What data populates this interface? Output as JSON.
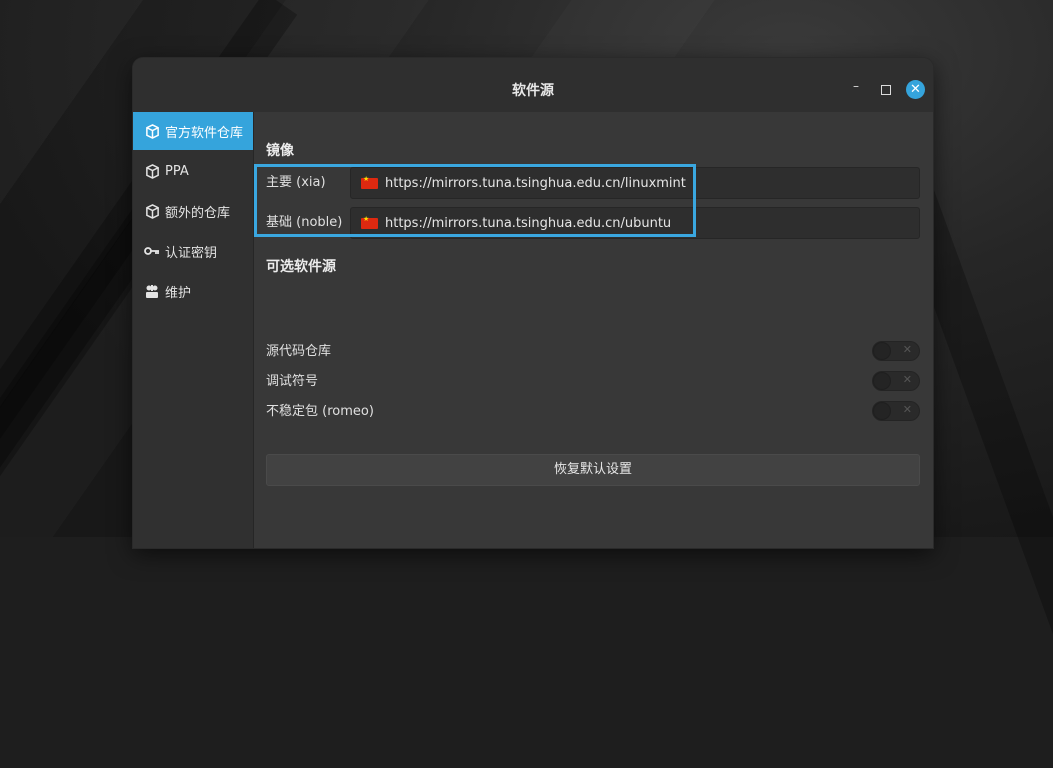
{
  "window": {
    "title": "软件源"
  },
  "sidebar": {
    "items": [
      {
        "label": "官方软件仓库",
        "icon": "package-icon",
        "active": true
      },
      {
        "label": "PPA",
        "icon": "package-icon",
        "active": false
      },
      {
        "label": "额外的仓库",
        "icon": "package-icon",
        "active": false
      },
      {
        "label": "认证密钥",
        "icon": "key-icon",
        "active": false
      },
      {
        "label": "维护",
        "icon": "maintenance-icon",
        "active": false
      }
    ]
  },
  "mirrors": {
    "title": "镜像",
    "main": {
      "label": "主要 (xia)",
      "url": "https://mirrors.tuna.tsinghua.edu.cn/linuxmint"
    },
    "base": {
      "label": "基础 (noble)",
      "url": "https://mirrors.tuna.tsinghua.edu.cn/ubuntu"
    }
  },
  "optional": {
    "title": "可选软件源",
    "items": [
      {
        "label": "源代码仓库",
        "enabled": false
      },
      {
        "label": "调试符号",
        "enabled": false
      },
      {
        "label": "不稳定包 (romeo)",
        "enabled": false
      }
    ]
  },
  "reset_label": "恢复默认设置",
  "colors": {
    "accent": "#35a4dc",
    "window_bg": "#383838",
    "highlight": "#3aa7e0"
  }
}
